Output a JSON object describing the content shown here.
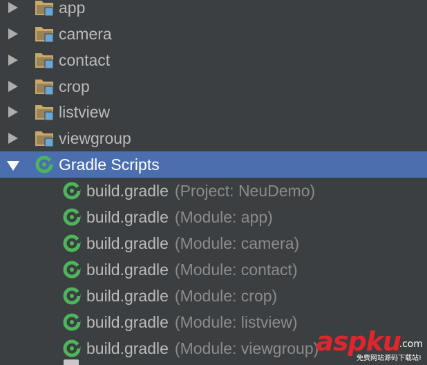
{
  "folders": [
    {
      "name": "app"
    },
    {
      "name": "camera"
    },
    {
      "name": "contact"
    },
    {
      "name": "crop"
    },
    {
      "name": "listview"
    },
    {
      "name": "viewgroup"
    }
  ],
  "gradle_scripts": {
    "label": "Gradle Scripts",
    "expanded": true,
    "selected": true,
    "items": [
      {
        "name": "build.gradle",
        "detail": "(Project: NeuDemo)"
      },
      {
        "name": "build.gradle",
        "detail": "(Module: app)"
      },
      {
        "name": "build.gradle",
        "detail": "(Module: camera)"
      },
      {
        "name": "build.gradle",
        "detail": "(Module: contact)"
      },
      {
        "name": "build.gradle",
        "detail": "(Module: crop)"
      },
      {
        "name": "build.gradle",
        "detail": "(Module: listview)"
      },
      {
        "name": "build.gradle",
        "detail": "(Module: viewgroup)"
      }
    ]
  },
  "icons": {
    "folder": "module-folder-icon",
    "gradle": "gradle-icon",
    "collapsed": "chevron-right-icon",
    "expanded": "chevron-down-icon"
  },
  "colors": {
    "background": "#3c3f41",
    "selection": "#4b6eaf",
    "text": "#bbbbbb",
    "secondary_text": "#8c8c8c",
    "folder": "#c9a868",
    "module_badge": "#6aa6d6",
    "gradle_green": "#4db65a"
  },
  "watermark": {
    "main": "aspku",
    "tld": ".com",
    "sub": "免费网站源码下载站!"
  }
}
